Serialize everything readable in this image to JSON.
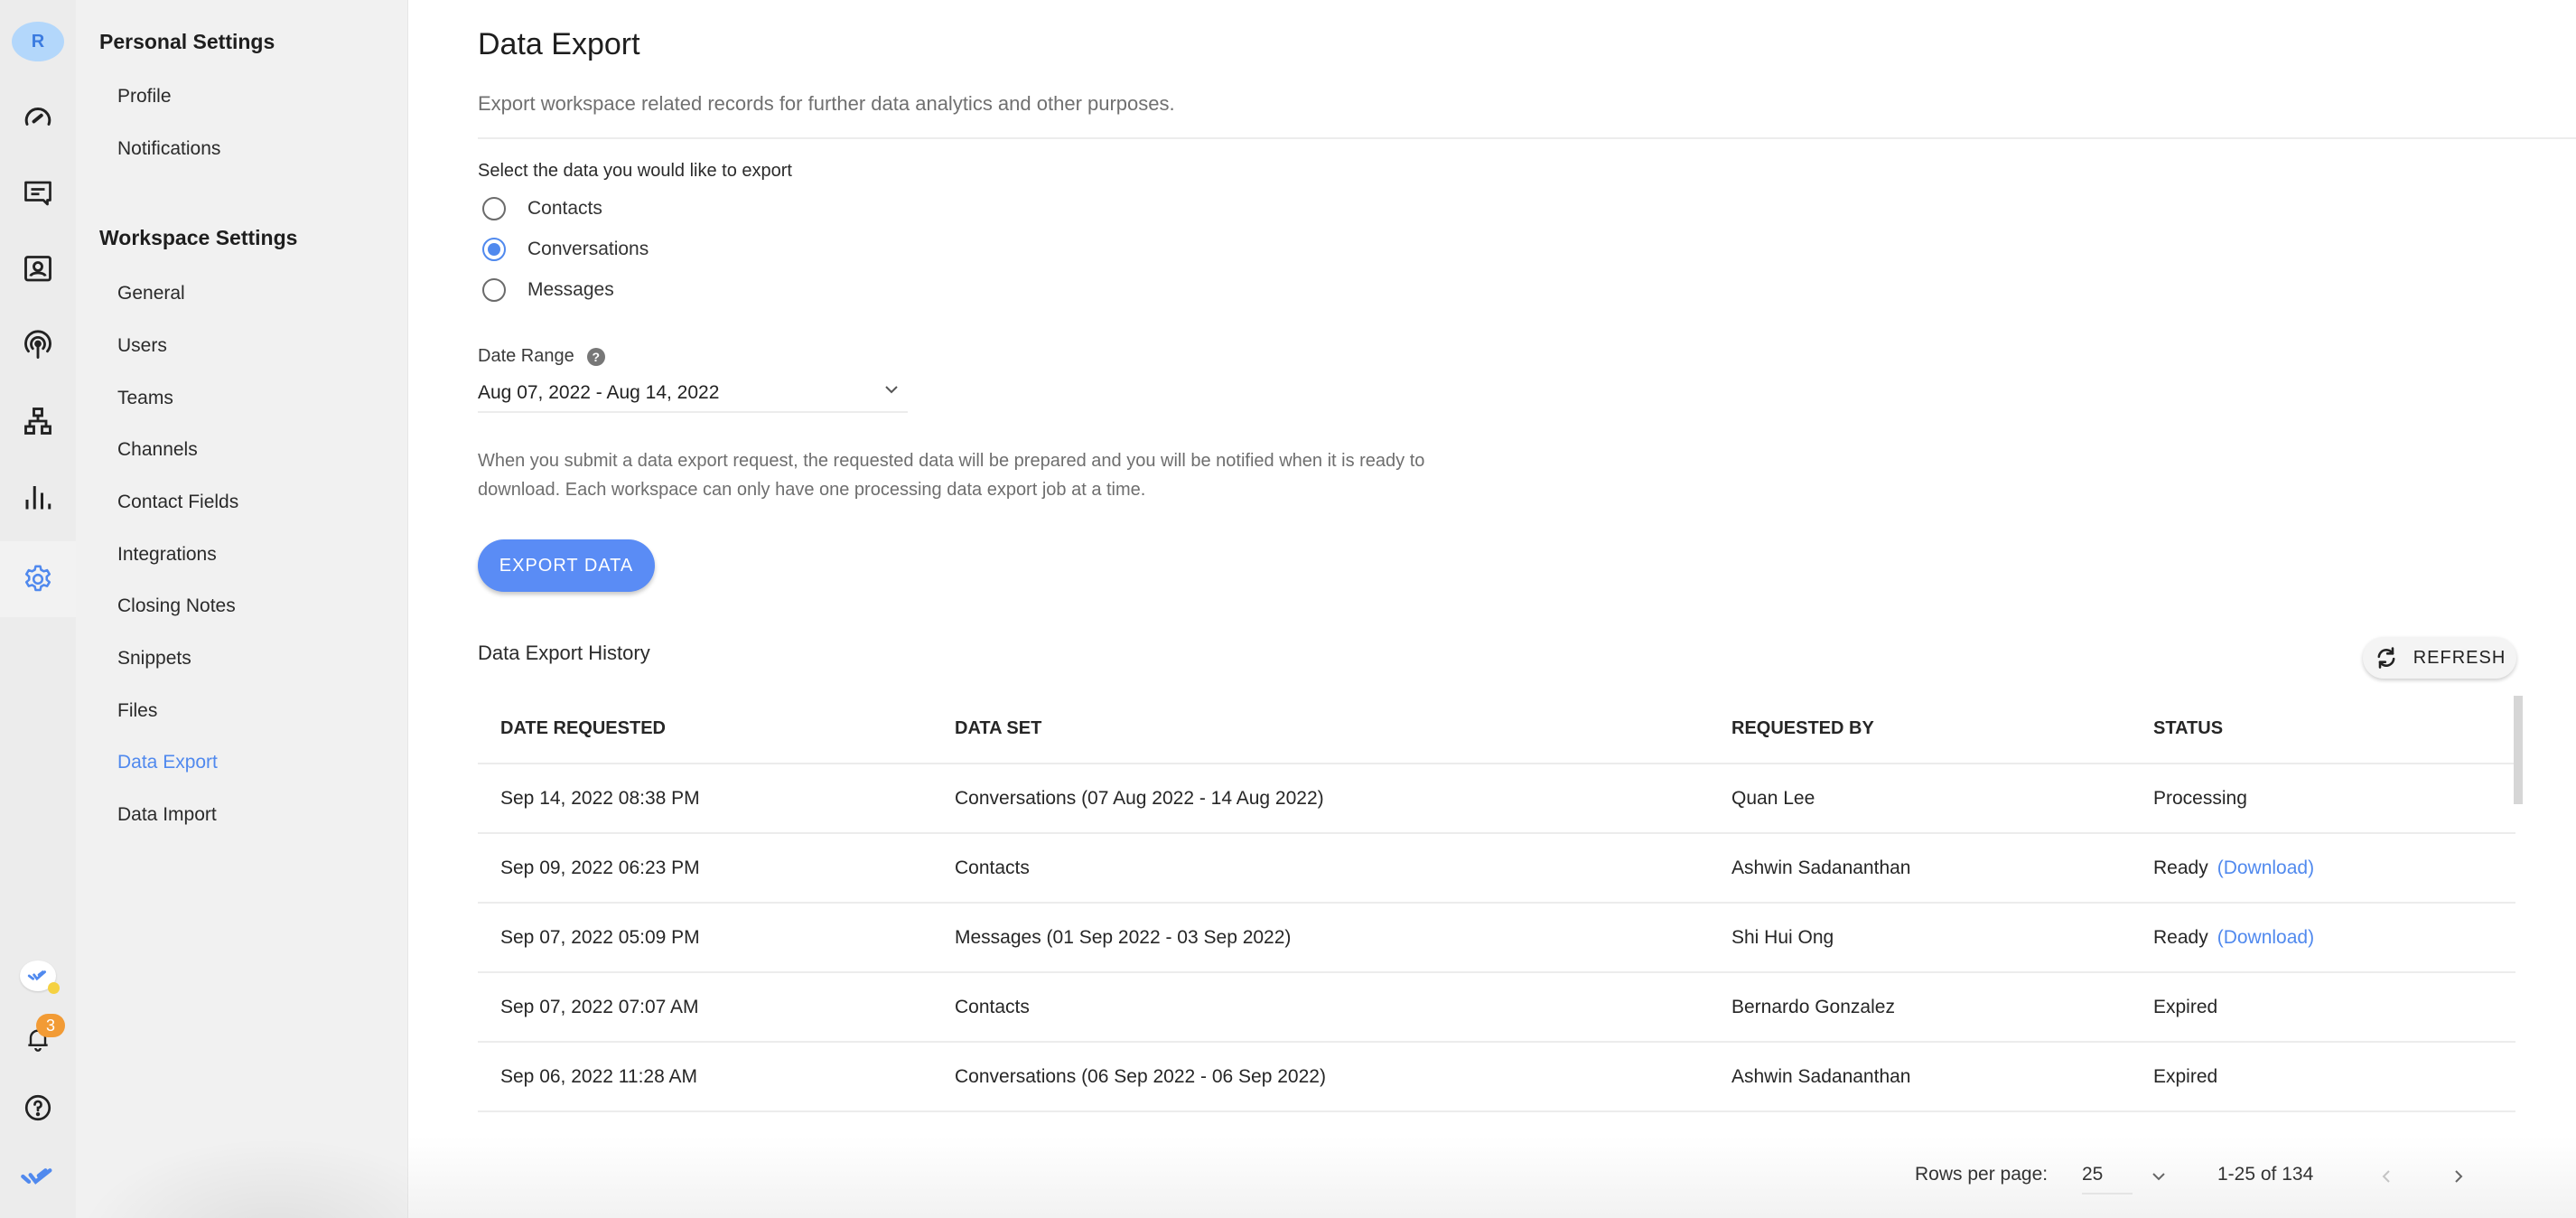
{
  "rail": {
    "avatar_initial": "R",
    "items": [
      {
        "name": "dashboard",
        "icon": "speedometer-icon"
      },
      {
        "name": "conversations",
        "icon": "chat-icon"
      },
      {
        "name": "contacts",
        "icon": "contact-card-icon"
      },
      {
        "name": "broadcasts",
        "icon": "broadcast-icon"
      },
      {
        "name": "workflows",
        "icon": "hierarchy-icon"
      },
      {
        "name": "reports",
        "icon": "bar-chart-icon"
      },
      {
        "name": "settings",
        "icon": "gear-icon",
        "active": true
      }
    ],
    "bottom": {
      "app_icon": "double-check-logo-icon",
      "notifications_count": "3",
      "help_icon": "help-circle-icon",
      "brand_icon": "double-check-logo-icon"
    }
  },
  "settings_nav": {
    "personal_title": "Personal Settings",
    "personal_items": [
      "Profile",
      "Notifications"
    ],
    "workspace_title": "Workspace Settings",
    "workspace_items": [
      "General",
      "Users",
      "Teams",
      "Channels",
      "Contact Fields",
      "Integrations",
      "Closing Notes",
      "Snippets",
      "Files",
      "Data Export",
      "Data Import"
    ],
    "active_item": "Data Export"
  },
  "main": {
    "title": "Data Export",
    "subtitle": "Export workspace related records for further data analytics and other purposes.",
    "select_label": "Select the data you would like to export",
    "options": [
      {
        "label": "Contacts",
        "checked": false
      },
      {
        "label": "Conversations",
        "checked": true
      },
      {
        "label": "Messages",
        "checked": false
      }
    ],
    "date_range_label": "Date Range",
    "date_range_help": "?",
    "date_range_value": "Aug 07, 2022 - Aug 14, 2022",
    "info_text": "When you submit a data export request, the requested data will be prepared and you will be notified when it is ready to download. Each workspace can only have one processing data export job at a time.",
    "export_button": "EXPORT DATA",
    "history_title": "Data Export History",
    "refresh_button": "REFRESH"
  },
  "table": {
    "columns": [
      "DATE REQUESTED",
      "DATA SET",
      "REQUESTED BY",
      "STATUS"
    ],
    "rows": [
      {
        "date": "Sep 14, 2022 08:38 PM",
        "dataset": "Conversations (07 Aug 2022 - 14 Aug 2022)",
        "requested_by": "Quan Lee",
        "status": "Processing",
        "link": ""
      },
      {
        "date": "Sep 09, 2022 06:23 PM",
        "dataset": "Contacts",
        "requested_by": "Ashwin Sadananthan",
        "status": "Ready",
        "link": "(Download)"
      },
      {
        "date": "Sep 07, 2022 05:09 PM",
        "dataset": "Messages (01 Sep 2022 - 03 Sep 2022)",
        "requested_by": "Shi Hui Ong",
        "status": "Ready",
        "link": "(Download)"
      },
      {
        "date": "Sep 07, 2022 07:07 AM",
        "dataset": "Contacts",
        "requested_by": "Bernardo Gonzalez",
        "status": "Expired",
        "link": ""
      },
      {
        "date": "Sep 06, 2022 11:28 AM",
        "dataset": "Conversations (06 Sep 2022 - 06 Sep 2022)",
        "requested_by": "Ashwin Sadananthan",
        "status": "Expired",
        "link": ""
      }
    ]
  },
  "pagination": {
    "rows_per_page_label": "Rows per page:",
    "rows_per_page_value": "25",
    "range_text": "1-25 of 134"
  },
  "colors": {
    "accent": "#5089ee",
    "button": "#5a8cf5",
    "badge": "#f29b35",
    "avatar_bg": "#b3d7fb"
  }
}
